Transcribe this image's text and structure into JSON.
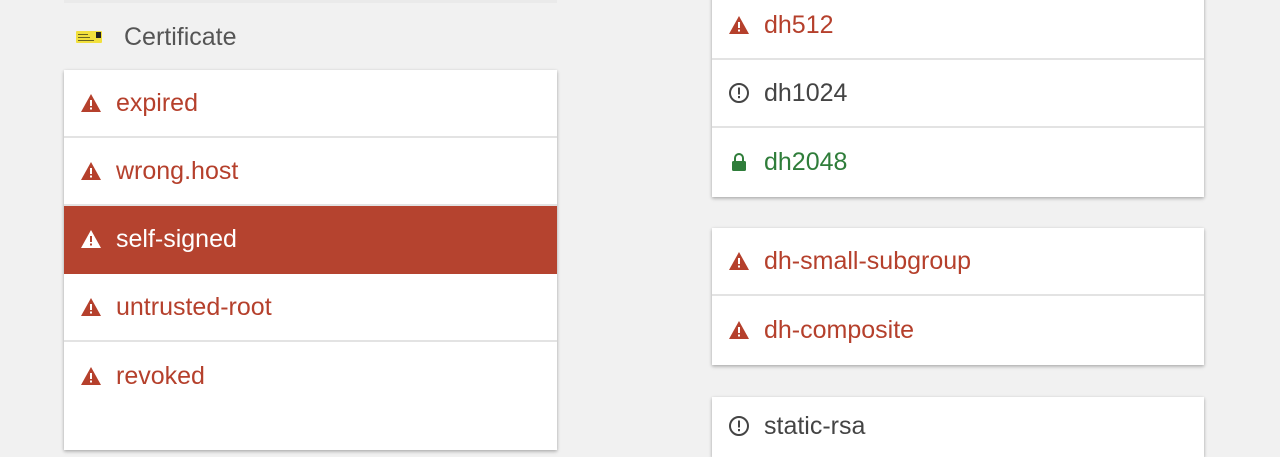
{
  "section": {
    "title": "Certificate",
    "icon": "certificate-icon"
  },
  "colors": {
    "bad": "#b5402c",
    "good": "#2f7d3a",
    "neutral": "#444444",
    "active_bg": "#b5432f"
  },
  "left_list": [
    {
      "label": "expired",
      "status": "bad",
      "icon": "warning-icon"
    },
    {
      "label": "wrong.host",
      "status": "bad",
      "icon": "warning-icon"
    },
    {
      "label": "self-signed",
      "status": "bad",
      "icon": "warning-icon",
      "selected": true
    },
    {
      "label": "untrusted-root",
      "status": "bad",
      "icon": "warning-icon"
    },
    {
      "label": "revoked",
      "status": "bad",
      "icon": "warning-icon"
    }
  ],
  "right_group_1": [
    {
      "label": "dh512",
      "status": "bad",
      "icon": "warning-icon"
    },
    {
      "label": "dh1024",
      "status": "neutral",
      "icon": "info-circle-icon"
    },
    {
      "label": "dh2048",
      "status": "good",
      "icon": "lock-icon"
    }
  ],
  "right_group_2": [
    {
      "label": "dh-small-subgroup",
      "status": "bad",
      "icon": "warning-icon"
    },
    {
      "label": "dh-composite",
      "status": "bad",
      "icon": "warning-icon"
    }
  ],
  "right_group_3": [
    {
      "label": "static-rsa",
      "status": "neutral",
      "icon": "info-circle-icon"
    }
  ]
}
